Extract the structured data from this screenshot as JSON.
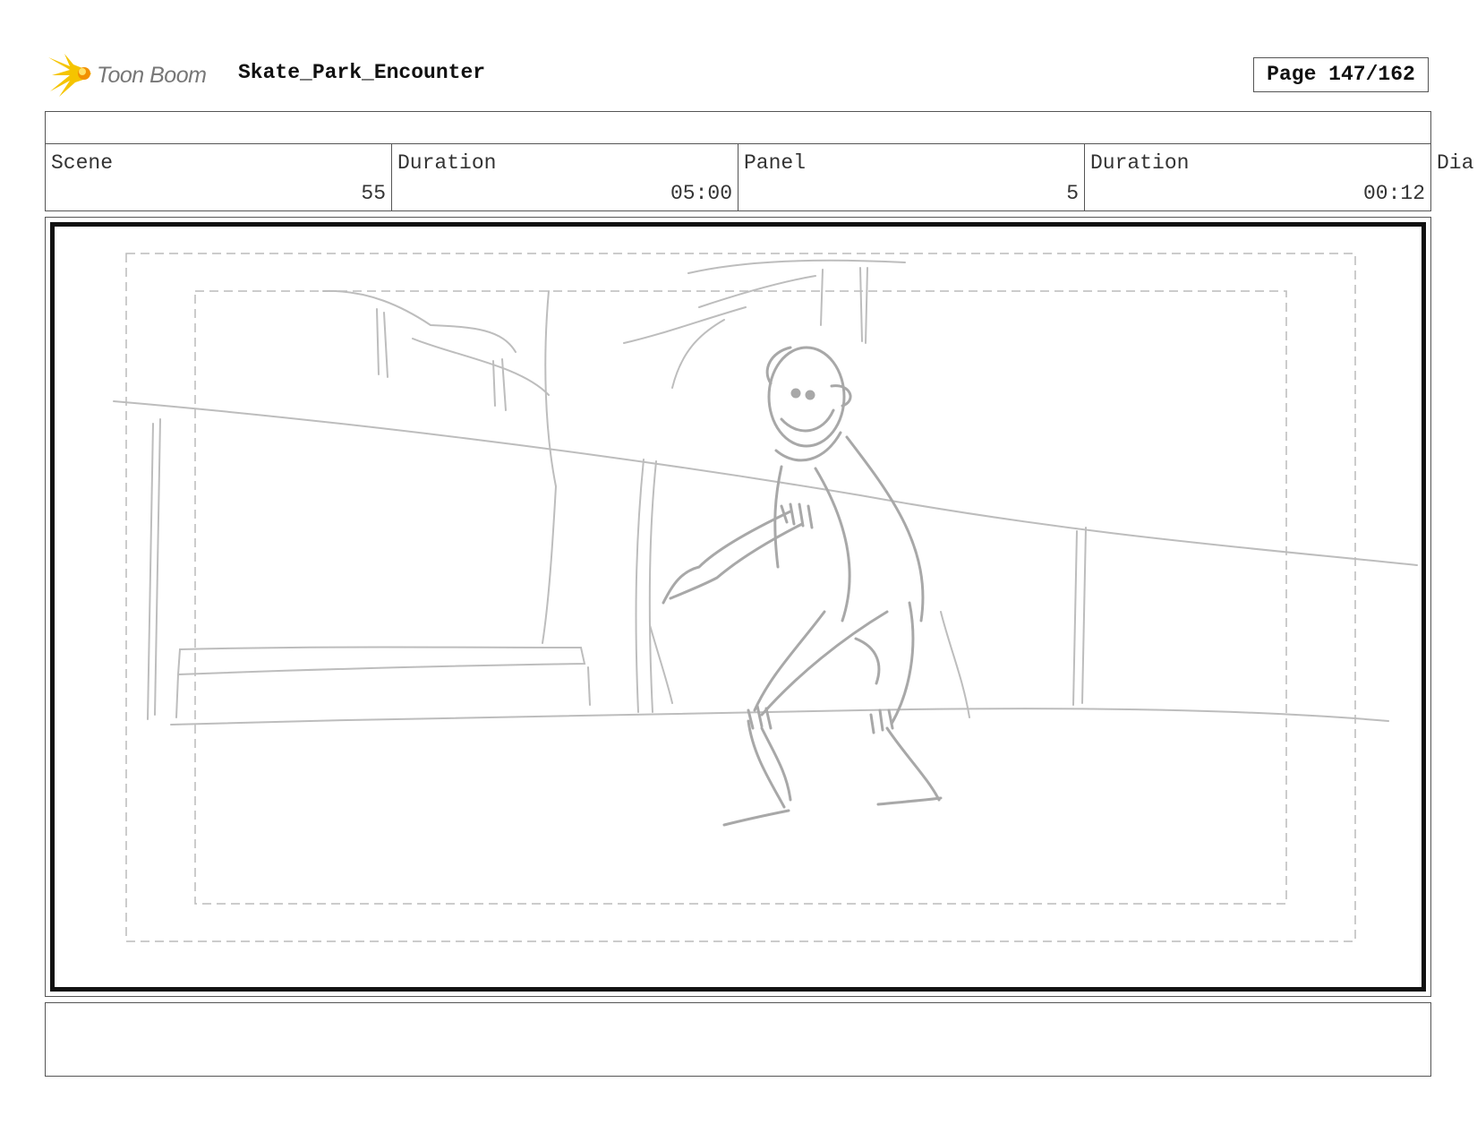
{
  "header": {
    "brand": "Toon Boom",
    "project_title": "Skate_Park_Encounter",
    "page_label": "Page 147/162"
  },
  "info": {
    "scene_label": "Scene",
    "scene_value": "55",
    "scene_duration_label": "Duration",
    "scene_duration_value": "05:00",
    "panel_label": "Panel",
    "panel_value": "5",
    "panel_duration_label": "Duration",
    "panel_duration_value": "00:12",
    "dialog_label": "Dia"
  },
  "colors": {
    "logo_yellow": "#f5c400",
    "logo_orange": "#f29100",
    "sketch_gray": "#b5b5b5",
    "safe_area_gray": "#bbbbbb"
  },
  "icons": {
    "logo": "toon-boom-starburst-icon"
  }
}
